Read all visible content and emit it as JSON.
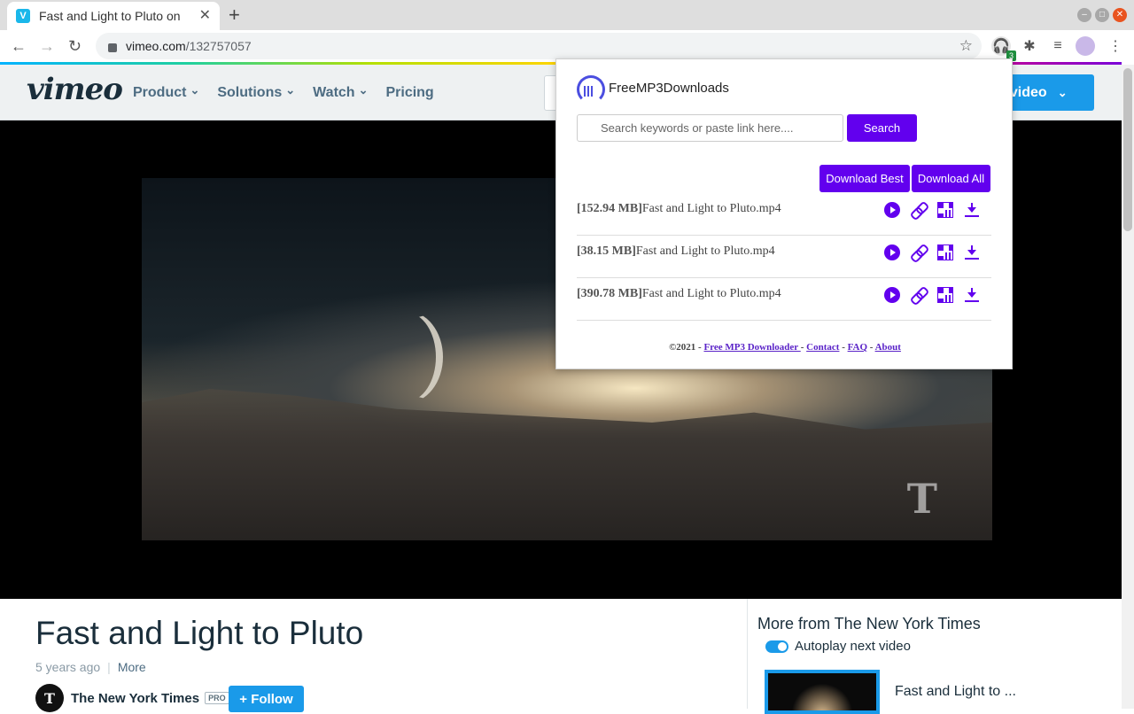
{
  "browser": {
    "tab_title": "Fast and Light to Pluto on",
    "tab_favicon": "V",
    "url_host": "vimeo.com",
    "url_path": "/132757057",
    "extension_badge": "3"
  },
  "vimeo": {
    "logo": "vimeo",
    "nav": [
      "Product",
      "Solutions",
      "Watch",
      "Pricing"
    ],
    "new_video": "w video"
  },
  "video": {
    "watermark": "T",
    "title": "Fast and Light to Pluto",
    "age": "5 years ago",
    "more": "More",
    "channel": "The New York Times",
    "channel_avatar": "T",
    "pro": "PRO",
    "follow": "+ Follow"
  },
  "sidebar": {
    "heading": "More from The New York Times",
    "autoplay": "Autoplay next video",
    "next_title": "Fast and Light to ..."
  },
  "popup": {
    "brand": "FreeMP3Downloads",
    "search_placeholder": "Search keywords or paste link here....",
    "search_button": "Search",
    "download_best": "Download Best",
    "download_all": "Download All",
    "files": [
      {
        "size": "[152.94 MB]",
        "name": "Fast and Light to Pluto.mp4"
      },
      {
        "size": "[38.15 MB]",
        "name": "Fast and Light to Pluto.mp4"
      },
      {
        "size": "[390.78 MB]",
        "name": "Fast and Light to Pluto.mp4"
      }
    ],
    "footer": {
      "copyright": "©2021 -",
      "link1": "Free MP3 Downloader ",
      "link2": "Contact",
      "link3": "FAQ",
      "link4": "About"
    }
  },
  "colors": {
    "popup_accent": "#6200ee",
    "vimeo_blue": "#1a9ae9"
  }
}
